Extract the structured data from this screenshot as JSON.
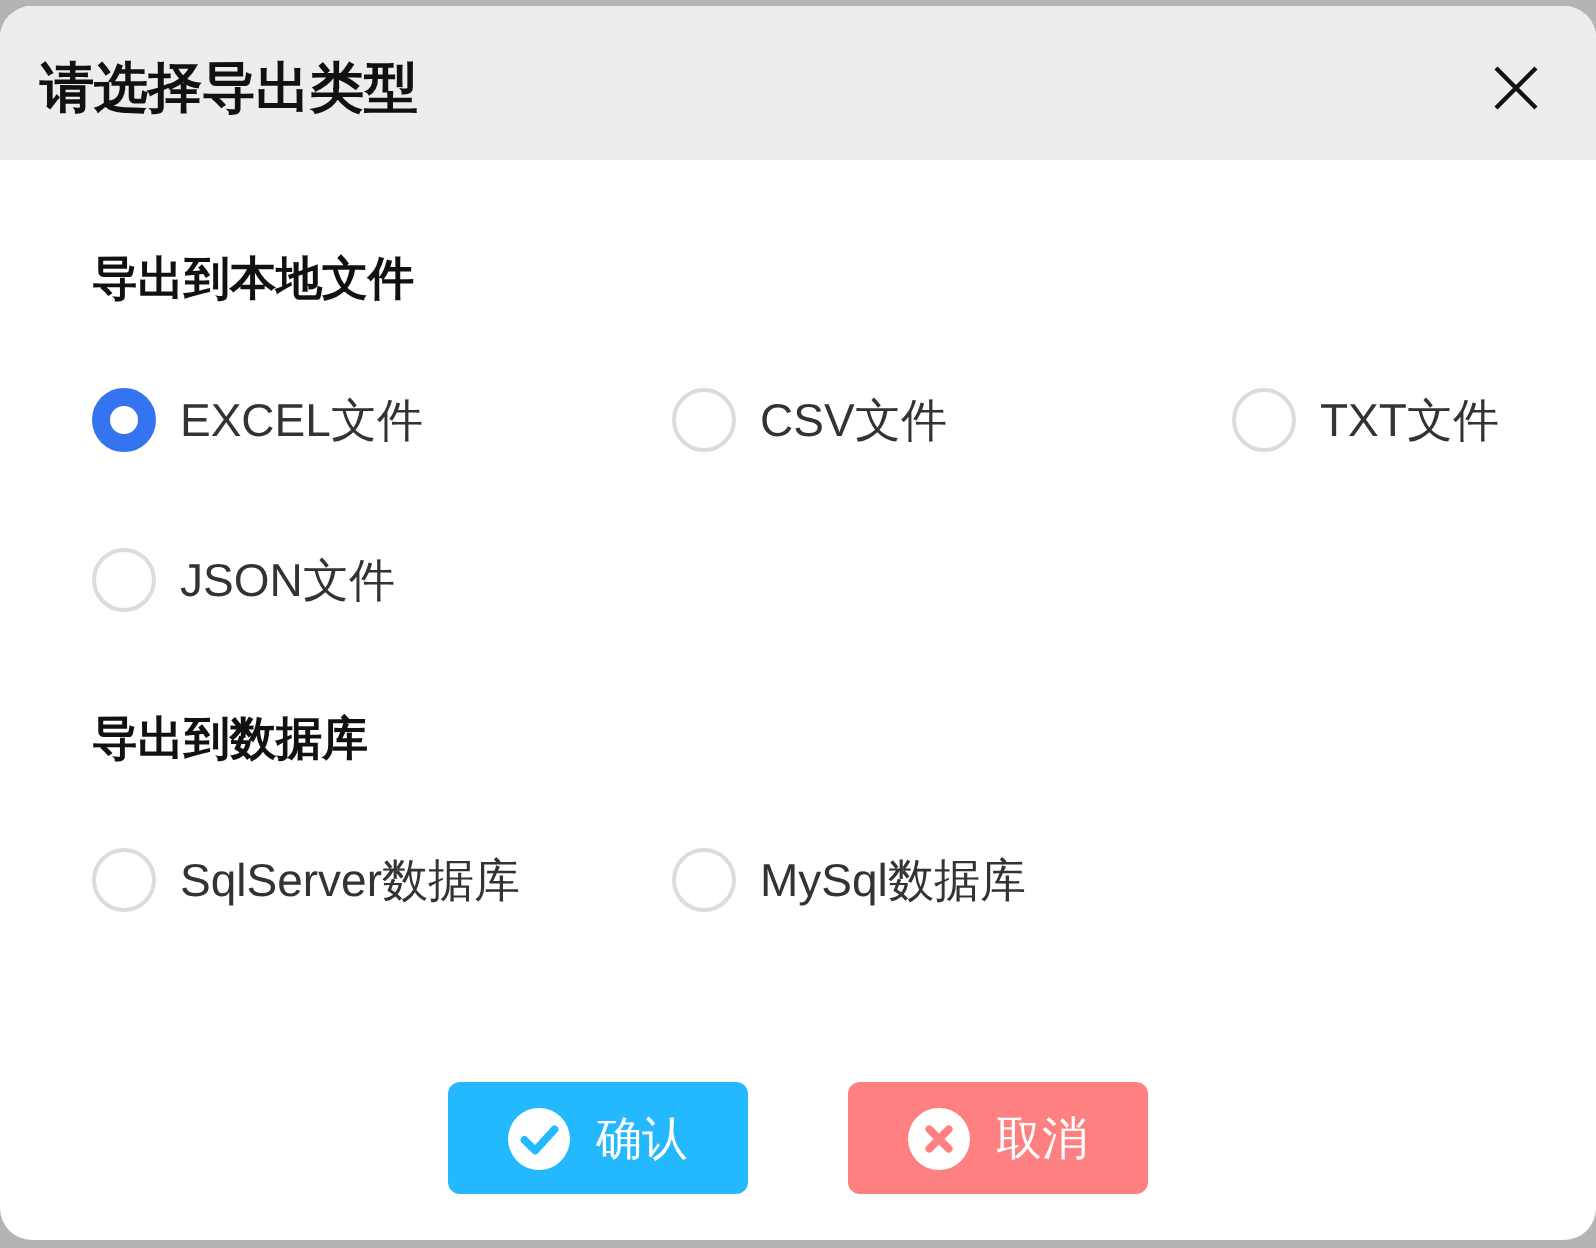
{
  "dialog": {
    "title": "请选择导出类型"
  },
  "sections": [
    {
      "heading": "导出到本地文件",
      "options": [
        {
          "label": "EXCEL文件",
          "selected": true
        },
        {
          "label": "CSV文件",
          "selected": false
        },
        {
          "label": "TXT文件",
          "selected": false
        },
        {
          "label": "JSON文件",
          "selected": false
        }
      ]
    },
    {
      "heading": "导出到数据库",
      "options": [
        {
          "label": "SqlServer数据库",
          "selected": false
        },
        {
          "label": "MySql数据库",
          "selected": false
        }
      ]
    }
  ],
  "buttons": [
    {
      "label": "确认",
      "kind": "confirm"
    },
    {
      "label": "取消",
      "kind": "cancel"
    }
  ]
}
